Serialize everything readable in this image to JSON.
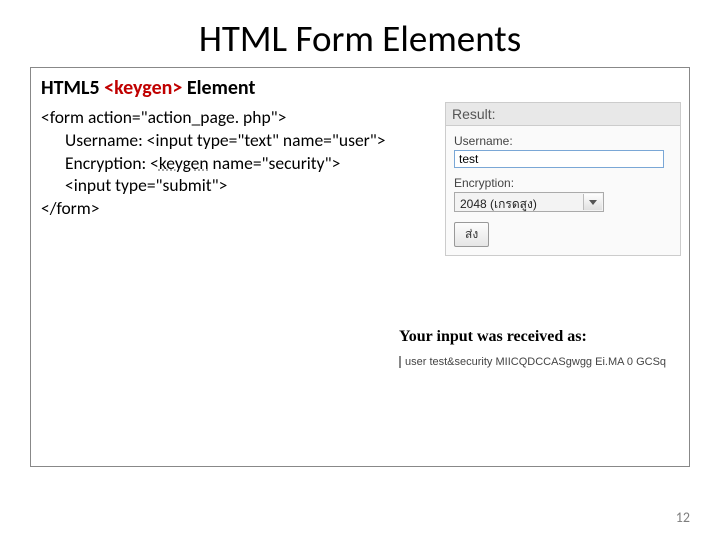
{
  "title": "HTML Form Elements",
  "subtitle_prefix": "HTML5 ",
  "subtitle_keyword": "<keygen>",
  "subtitle_suffix": " Element",
  "code": {
    "l1": "<form action=\"action_page. php\">",
    "l2": "Username: <input type=\"text\" name=\"user\">",
    "l3_pre": "Encryption: <",
    "l3_kw": "keygen",
    "l3_post": " name=\"security\">",
    "l4": "<input type=\"submit\">",
    "l5": "</form>"
  },
  "form": {
    "result_header": "Result:",
    "username_label": "Username:",
    "username_value": "test",
    "encryption_label": "Encryption:",
    "encryption_value": "2048 (เกรดสูง)",
    "submit_label": "ส่ง"
  },
  "received": {
    "title": "Your input was received as:",
    "value": "user  test&security  MIICQDCCASgwgg Ei.MA 0 GCSq"
  },
  "page_number": "12"
}
